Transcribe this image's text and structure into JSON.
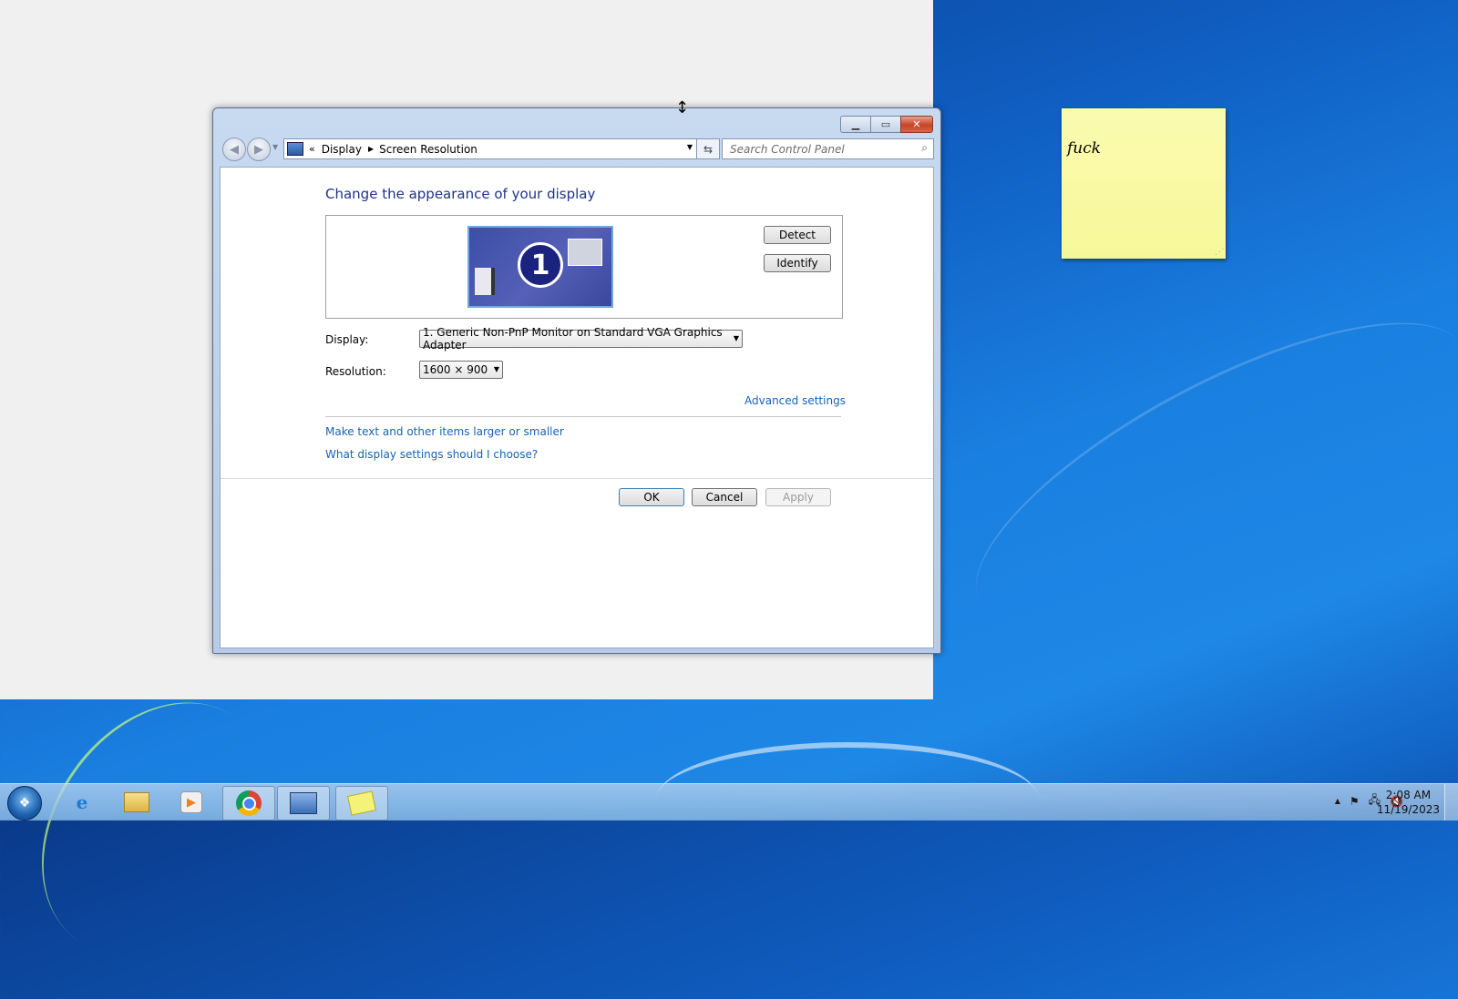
{
  "window": {
    "breadcrumb": {
      "root_chevron": "«",
      "items": [
        "Display",
        "Screen Resolution"
      ]
    },
    "search": {
      "placeholder": "Search Control Panel"
    }
  },
  "content": {
    "heading": "Change the appearance of your display",
    "monitor_number": "1",
    "detect_label": "Detect",
    "identify_label": "Identify",
    "display_label": "Display:",
    "display_value": "1. Generic Non-PnP Monitor on Standard VGA Graphics Adapter",
    "resolution_label": "Resolution:",
    "resolution_value": "1600 × 900",
    "advanced_link": "Advanced settings",
    "link_text_size": "Make text and other items larger or smaller",
    "link_display_help": "What display settings should I choose?",
    "ok_label": "OK",
    "cancel_label": "Cancel",
    "apply_label": "Apply"
  },
  "sticky_note": {
    "text": "fuck"
  },
  "taskbar": {
    "clock_time": "2:08 AM",
    "clock_date": "11/19/2023"
  },
  "colors": {
    "heading": "#1e3287",
    "link": "#1662b8",
    "sticky": "#f7f79a",
    "desktop": "#1a7fe0"
  }
}
